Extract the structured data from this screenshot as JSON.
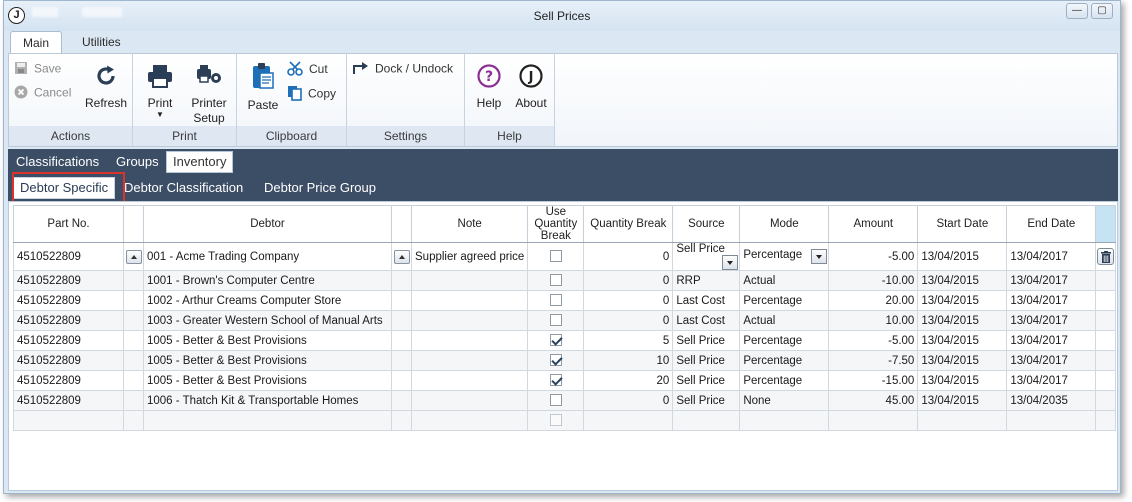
{
  "window": {
    "title": "Sell Prices",
    "icon_letter": "J",
    "controls": {
      "minimize": "—",
      "restore": "▢"
    }
  },
  "ribbon_tabs": [
    {
      "label": "Main",
      "active": true
    },
    {
      "label": "Utilities",
      "active": false
    }
  ],
  "ribbon": {
    "actions": {
      "save_label": "Save",
      "cancel_label": "Cancel",
      "refresh_label": "Refresh",
      "group_label": "Actions"
    },
    "print": {
      "print_label": "Print",
      "printer_setup_line1": "Printer",
      "printer_setup_line2": "Setup",
      "group_label": "Print"
    },
    "clipboard": {
      "paste_label": "Paste",
      "cut_label": "Cut",
      "copy_label": "Copy",
      "group_label": "Clipboard"
    },
    "settings": {
      "dock_label": "Dock / Undock",
      "group_label": "Settings"
    },
    "help": {
      "help_label": "Help",
      "about_label": "About",
      "group_label": "Help"
    }
  },
  "category_tabs": [
    {
      "label": "Classifications",
      "active": false
    },
    {
      "label": "Groups",
      "active": false
    },
    {
      "label": "Inventory",
      "active": true
    }
  ],
  "sub_tabs": [
    {
      "label": "Debtor Specific",
      "active": true
    },
    {
      "label": "Debtor Classification",
      "active": false
    },
    {
      "label": "Debtor Price Group",
      "active": false
    }
  ],
  "grid": {
    "columns": {
      "part_no": "Part No.",
      "debtor": "Debtor",
      "note": "Note",
      "use_qty_break": "Use Quantity Break",
      "qty_break": "Quantity Break",
      "source": "Source",
      "mode": "Mode",
      "amount": "Amount",
      "start_date": "Start Date",
      "end_date": "End Date"
    },
    "rows": [
      {
        "part_no": "4510522809",
        "debtor": "001 - Acme Trading Company",
        "note": "Supplier agreed price",
        "use_qty_break": false,
        "qty_break": "0",
        "source": "Sell Price",
        "mode": "Percentage",
        "amount": "-5.00",
        "start_date": "13/04/2015",
        "end_date": "13/04/2017"
      },
      {
        "part_no": "4510522809",
        "debtor": "1001 - Brown's Computer Centre",
        "note": "",
        "use_qty_break": false,
        "qty_break": "0",
        "source": "RRP",
        "mode": "Actual",
        "amount": "-10.00",
        "start_date": "13/04/2015",
        "end_date": "13/04/2017"
      },
      {
        "part_no": "4510522809",
        "debtor": "1002 - Arthur Creams Computer Store",
        "note": "",
        "use_qty_break": false,
        "qty_break": "0",
        "source": "Last Cost",
        "mode": "Percentage",
        "amount": "20.00",
        "start_date": "13/04/2015",
        "end_date": "13/04/2017"
      },
      {
        "part_no": "4510522809",
        "debtor": "1003 - Greater Western School of Manual Arts",
        "note": "",
        "use_qty_break": false,
        "qty_break": "0",
        "source": "Last Cost",
        "mode": "Actual",
        "amount": "10.00",
        "start_date": "13/04/2015",
        "end_date": "13/04/2017"
      },
      {
        "part_no": "4510522809",
        "debtor": "1005 - Better & Best Provisions",
        "note": "",
        "use_qty_break": true,
        "qty_break": "5",
        "source": "Sell Price",
        "mode": "Percentage",
        "amount": "-5.00",
        "start_date": "13/04/2015",
        "end_date": "13/04/2017"
      },
      {
        "part_no": "4510522809",
        "debtor": "1005 - Better & Best Provisions",
        "note": "",
        "use_qty_break": true,
        "qty_break": "10",
        "source": "Sell Price",
        "mode": "Percentage",
        "amount": "-7.50",
        "start_date": "13/04/2015",
        "end_date": "13/04/2017"
      },
      {
        "part_no": "4510522809",
        "debtor": "1005 - Better & Best Provisions",
        "note": "",
        "use_qty_break": true,
        "qty_break": "20",
        "source": "Sell Price",
        "mode": "Percentage",
        "amount": "-15.00",
        "start_date": "13/04/2015",
        "end_date": "13/04/2017"
      },
      {
        "part_no": "4510522809",
        "debtor": "1006 - Thatch Kit & Transportable Homes",
        "note": "",
        "use_qty_break": false,
        "qty_break": "0",
        "source": "Sell Price",
        "mode": "None",
        "amount": "45.00",
        "start_date": "13/04/2015",
        "end_date": "13/04/2035"
      }
    ]
  },
  "colors": {
    "accent_dark": "#3c4e66",
    "highlight_red": "#d9332c",
    "help_purple": "#8c2f95"
  }
}
